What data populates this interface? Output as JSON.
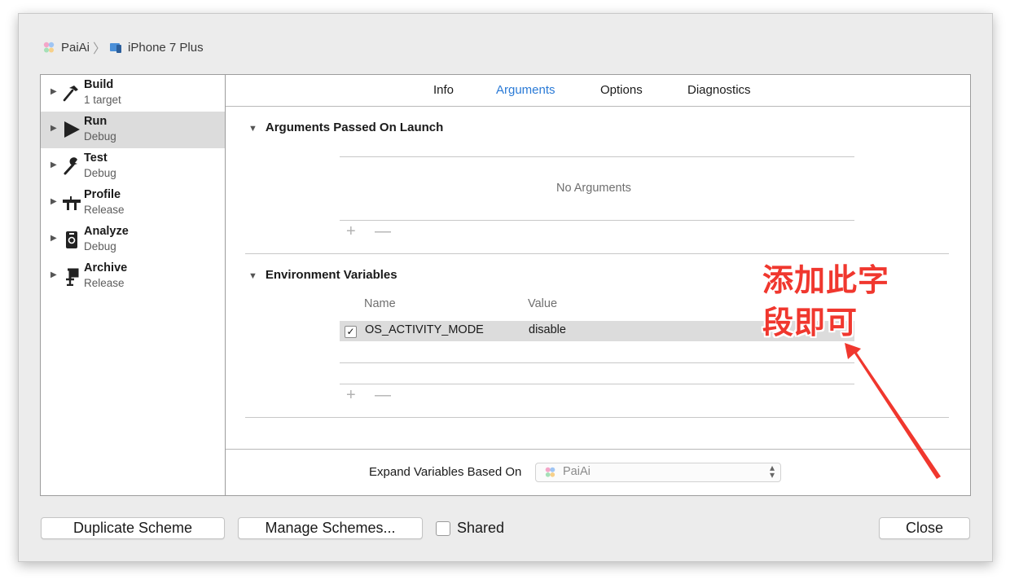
{
  "breadcrumb": {
    "project": "PaiAi",
    "separator": "〉",
    "device": "iPhone 7 Plus"
  },
  "sidebar": {
    "items": [
      {
        "name": "Build",
        "sub": "1 target",
        "icon": "hammer-icon",
        "selected": false
      },
      {
        "name": "Run",
        "sub": "Debug",
        "icon": "play-icon",
        "selected": true
      },
      {
        "name": "Test",
        "sub": "Debug",
        "icon": "wrench-icon",
        "selected": false
      },
      {
        "name": "Profile",
        "sub": "Release",
        "icon": "instruments-icon",
        "selected": false
      },
      {
        "name": "Analyze",
        "sub": "Debug",
        "icon": "analyze-icon",
        "selected": false
      },
      {
        "name": "Archive",
        "sub": "Release",
        "icon": "archive-icon",
        "selected": false
      }
    ]
  },
  "tabs": [
    {
      "label": "Info",
      "active": false
    },
    {
      "label": "Arguments",
      "active": true
    },
    {
      "label": "Options",
      "active": false
    },
    {
      "label": "Diagnostics",
      "active": false
    }
  ],
  "arguments": {
    "title": "Arguments Passed On Launch",
    "empty_text": "No Arguments",
    "add": "+",
    "remove": "—"
  },
  "environment": {
    "title": "Environment Variables",
    "col_name": "Name",
    "col_value": "Value",
    "rows": [
      {
        "checked": true,
        "check_mark": "✓",
        "name": "OS_ACTIVITY_MODE",
        "value": "disable"
      }
    ],
    "add": "+",
    "remove": "—"
  },
  "expand": {
    "label": "Expand Variables Based On",
    "value": "PaiAi"
  },
  "footer": {
    "duplicate": "Duplicate Scheme",
    "manage": "Manage Schemes...",
    "shared": "Shared",
    "close": "Close"
  },
  "annotation": {
    "line1": "添加此字",
    "line2": "段即可"
  },
  "colors": {
    "accent": "#2a7ad6",
    "annotation": "#f0372e",
    "selection": "#dcdcdc"
  }
}
